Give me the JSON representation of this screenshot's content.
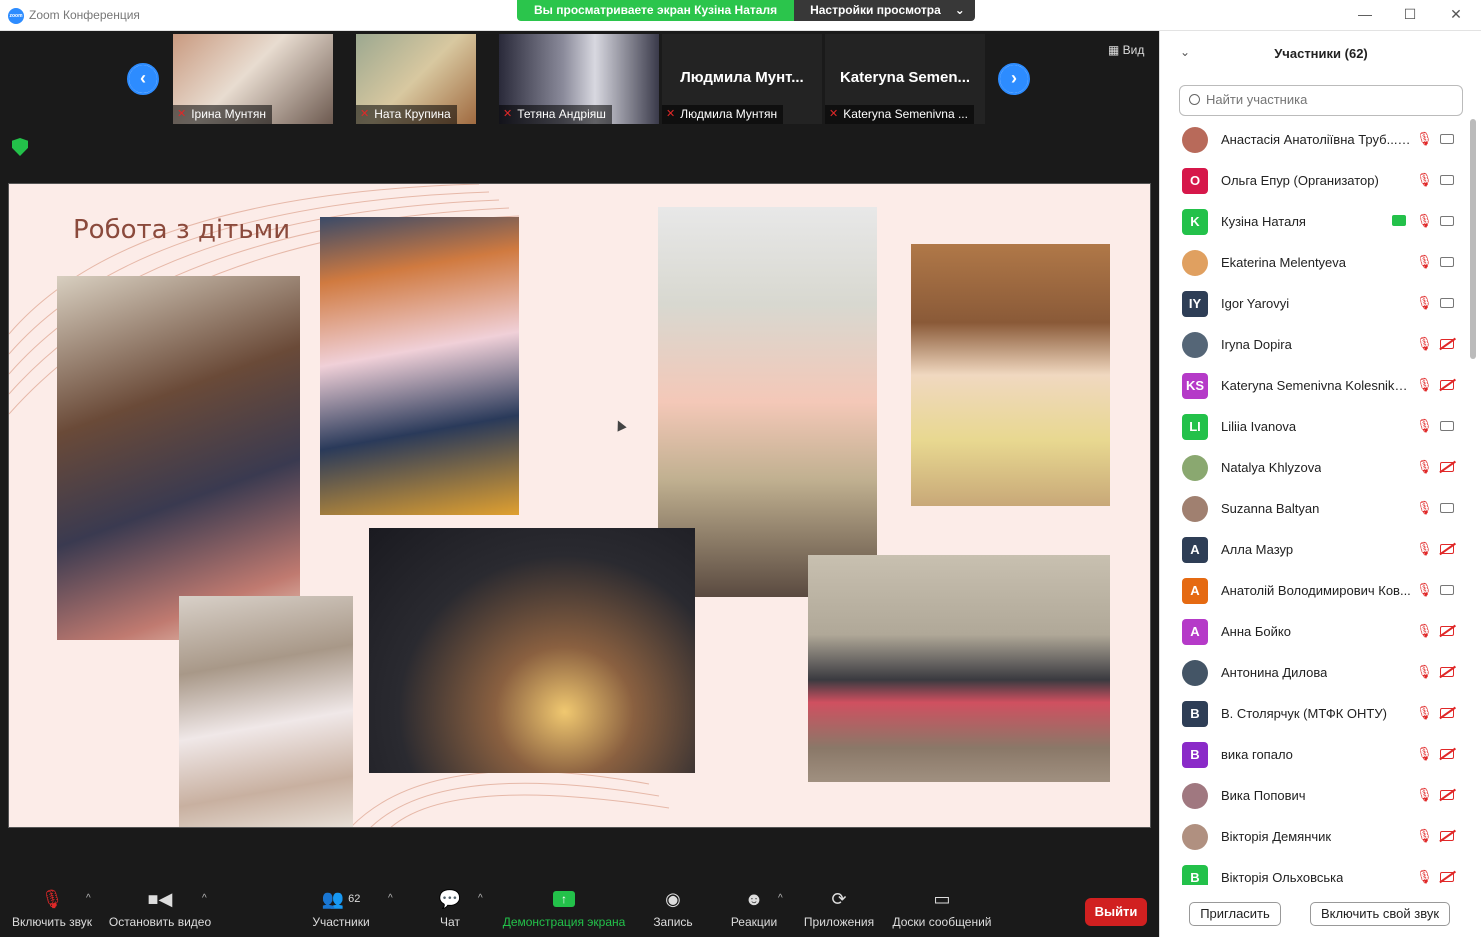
{
  "window": {
    "title": "Zoom Конференция",
    "logo_text": "zoom"
  },
  "share_banner": {
    "text": "Вы просматриваете экран Кузіна Наталя",
    "settings": "Настройки просмотра",
    "caret": "⌄"
  },
  "window_controls": {
    "minimize": "—",
    "maximize": "☐",
    "close": "✕"
  },
  "gallery": {
    "view_label": "Вид",
    "thumbnails": [
      {
        "caption": "Ірина Мунтян",
        "overlay_name": ""
      },
      {
        "caption": "Ната Крупина",
        "overlay_name": ""
      },
      {
        "caption": "Тетяна Андріяш",
        "overlay_name": ""
      },
      {
        "caption": "Людмила Мунтян",
        "overlay_name": "Людмила Мунт..."
      },
      {
        "caption": "Kateryna Semenivna ...",
        "overlay_name": "Kateryna Semen..."
      }
    ]
  },
  "slide": {
    "title": "Робота з дітьми"
  },
  "toolbar": {
    "mute": "Включить звук",
    "video": "Остановить видео",
    "participants": "Участники",
    "participants_count": "62",
    "chat": "Чат",
    "share": "Демонстрация экрана",
    "record": "Запись",
    "reactions": "Реакции",
    "apps": "Приложения",
    "whiteboards": "Доски сообщений",
    "leave": "Выйти"
  },
  "panel": {
    "title": "Участники (62)",
    "search_placeholder": "Найти участника",
    "invite": "Пригласить",
    "unmute_self": "Включить свой звук",
    "participants": [
      {
        "name": "Анастасія Анатоліївна Труб... (Я)",
        "avatar": "",
        "color": "#b86a5a",
        "video": true
      },
      {
        "name": "Ольга Епур (Организатор)",
        "avatar": "O",
        "color": "#d6174a",
        "video": true
      },
      {
        "name": "Кузіна Наталя",
        "avatar": "K",
        "color": "#23c14a",
        "video": true
      },
      {
        "name": "Ekaterina Melentyeva",
        "avatar": "",
        "color": "#e0a060",
        "video": true
      },
      {
        "name": "Igor Yarovyi",
        "avatar": "IY",
        "color": "#2e3e56",
        "video": true
      },
      {
        "name": "Iryna Dopira",
        "avatar": "",
        "color": "#556677",
        "video": false
      },
      {
        "name": "Kateryna Semenivna Kolesnikova",
        "avatar": "KS",
        "color": "#b53ac8",
        "video": false
      },
      {
        "name": "Liliia Ivanova",
        "avatar": "LI",
        "color": "#23c14a",
        "video": true
      },
      {
        "name": "Natalya Khlyzova",
        "avatar": "",
        "color": "#8aa870",
        "video": false
      },
      {
        "name": "Suzanna Baltyan",
        "avatar": "",
        "color": "#a08070",
        "video": true
      },
      {
        "name": "Алла Мазур",
        "avatar": "A",
        "color": "#2e3e56",
        "video": false
      },
      {
        "name": "Анатолій Володимирович Ков...",
        "avatar": "A",
        "color": "#e56a12",
        "video": true
      },
      {
        "name": "Анна Бойко",
        "avatar": "A",
        "color": "#b53ac8",
        "video": false
      },
      {
        "name": "Антонина Дилова",
        "avatar": "",
        "color": "#445566",
        "video": false
      },
      {
        "name": "В. Столярчук (МТФК ОНТУ)",
        "avatar": "B",
        "color": "#2e3e56",
        "video": false
      },
      {
        "name": "вика гопало",
        "avatar": "B",
        "color": "#8a2ac8",
        "video": false
      },
      {
        "name": "Вика Попович",
        "avatar": "",
        "color": "#a07880",
        "video": false
      },
      {
        "name": "Вікторія Демянчик",
        "avatar": "",
        "color": "#b09080",
        "video": false
      },
      {
        "name": "Вікторія Ольховська",
        "avatar": "B",
        "color": "#23c14a",
        "video": false
      }
    ]
  }
}
